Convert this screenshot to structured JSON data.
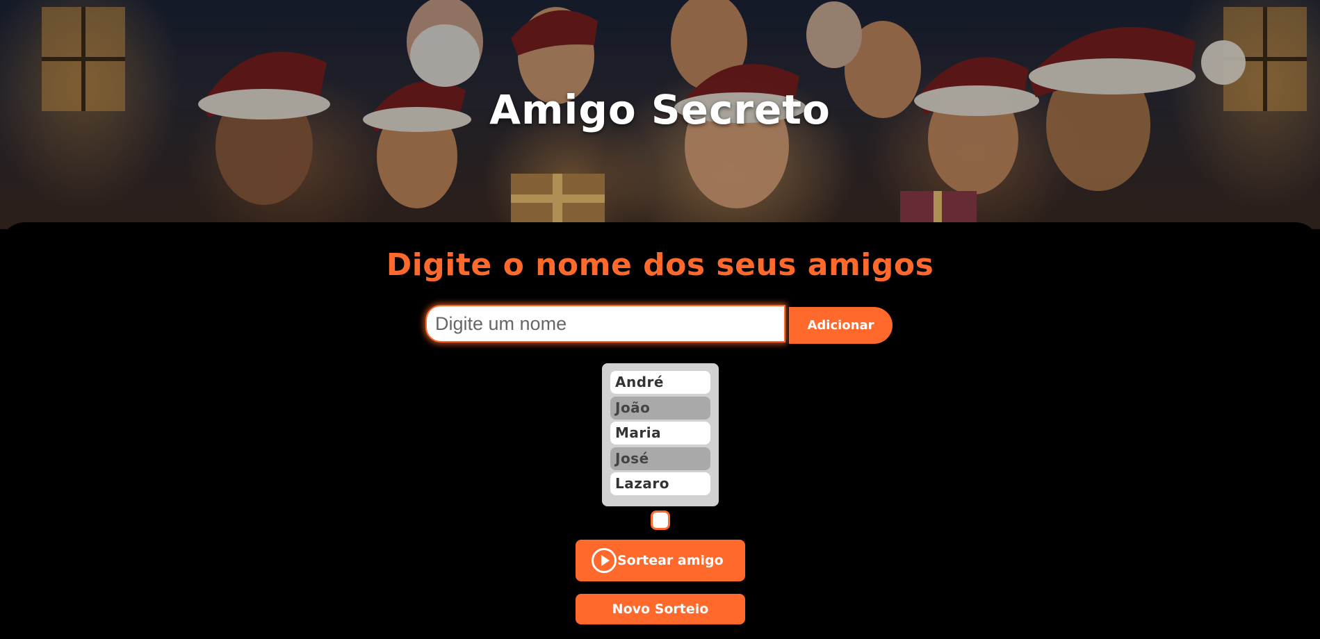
{
  "header": {
    "title": "Amigo Secreto"
  },
  "main": {
    "subtitle": "Digite o nome dos seus amigos",
    "input": {
      "placeholder": "Digite um nome",
      "value": ""
    },
    "add_button_label": "Adicionar",
    "friends": [
      "André",
      "João",
      "Maria",
      "José",
      "Lazaro"
    ],
    "result": "",
    "draw_button_label": "Sortear amigo",
    "draw_button_icon": "play-circle-icon",
    "reset_button_label": "Novo Sorteio"
  },
  "colors": {
    "accent": "#ff6a2c",
    "background": "#000000",
    "list_background": "#d1d1d1",
    "list_item_odd": "#ffffff",
    "list_item_even": "#a9a9a9"
  }
}
